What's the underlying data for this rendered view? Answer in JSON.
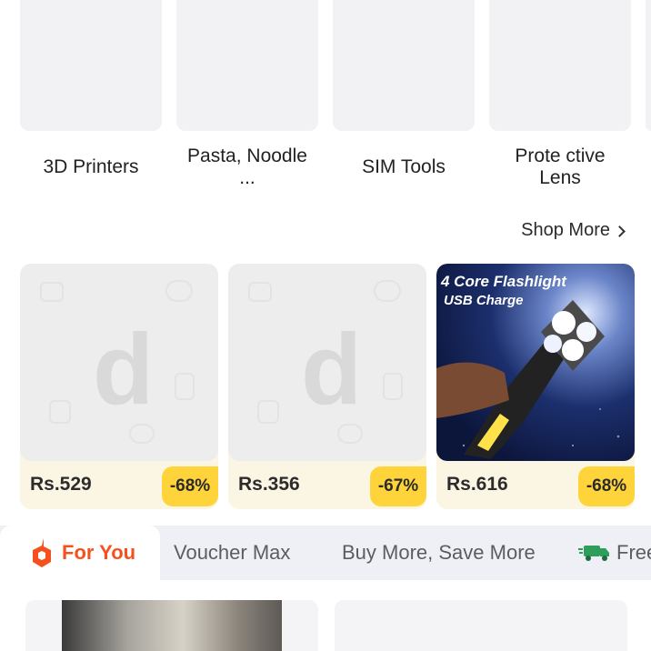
{
  "categories": [
    {
      "label": "3D Printers"
    },
    {
      "label": "Pasta, Noodle ..."
    },
    {
      "label": "SIM Tools"
    },
    {
      "label": "Prote ctive Lens"
    }
  ],
  "shop_more": {
    "label": "Shop More",
    "icon": "chevron-right-icon"
  },
  "products": [
    {
      "price": "Rs.529",
      "discount": "-68%",
      "image": "placeholder"
    },
    {
      "price": "Rs.356",
      "discount": "-67%",
      "image": "placeholder"
    },
    {
      "price": "Rs.616",
      "discount": "-68%",
      "image": "flashlight",
      "image_text": {
        "title": "4 Core Flashlight",
        "subtitle": "USB Charge"
      }
    }
  ],
  "tabs": [
    {
      "label": "For You",
      "active": true,
      "icon": "brand-logo-icon"
    },
    {
      "label": "Voucher Max",
      "active": false
    },
    {
      "label": "Buy More, Save More",
      "active": false
    },
    {
      "label": "Free",
      "active": false,
      "icon": "free-delivery-truck-icon"
    }
  ],
  "colors": {
    "accent": "#f4511e",
    "discount_badge": "#ffd43a",
    "price_bar": "#fbf6e4",
    "tab_bar": "#eef0f5"
  }
}
